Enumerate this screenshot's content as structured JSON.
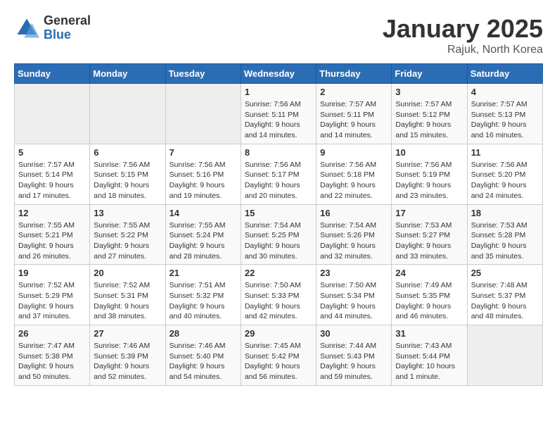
{
  "logo": {
    "general": "General",
    "blue": "Blue"
  },
  "title": "January 2025",
  "subtitle": "Rajuk, North Korea",
  "days_of_week": [
    "Sunday",
    "Monday",
    "Tuesday",
    "Wednesday",
    "Thursday",
    "Friday",
    "Saturday"
  ],
  "weeks": [
    [
      {
        "day": "",
        "empty": true
      },
      {
        "day": "",
        "empty": true
      },
      {
        "day": "",
        "empty": true
      },
      {
        "day": "1",
        "sunrise": "7:56 AM",
        "sunset": "5:11 PM",
        "daylight": "9 hours and 14 minutes."
      },
      {
        "day": "2",
        "sunrise": "7:57 AM",
        "sunset": "5:11 PM",
        "daylight": "9 hours and 14 minutes."
      },
      {
        "day": "3",
        "sunrise": "7:57 AM",
        "sunset": "5:12 PM",
        "daylight": "9 hours and 15 minutes."
      },
      {
        "day": "4",
        "sunrise": "7:57 AM",
        "sunset": "5:13 PM",
        "daylight": "9 hours and 16 minutes."
      }
    ],
    [
      {
        "day": "5",
        "sunrise": "7:57 AM",
        "sunset": "5:14 PM",
        "daylight": "9 hours and 17 minutes."
      },
      {
        "day": "6",
        "sunrise": "7:56 AM",
        "sunset": "5:15 PM",
        "daylight": "9 hours and 18 minutes."
      },
      {
        "day": "7",
        "sunrise": "7:56 AM",
        "sunset": "5:16 PM",
        "daylight": "9 hours and 19 minutes."
      },
      {
        "day": "8",
        "sunrise": "7:56 AM",
        "sunset": "5:17 PM",
        "daylight": "9 hours and 20 minutes."
      },
      {
        "day": "9",
        "sunrise": "7:56 AM",
        "sunset": "5:18 PM",
        "daylight": "9 hours and 22 minutes."
      },
      {
        "day": "10",
        "sunrise": "7:56 AM",
        "sunset": "5:19 PM",
        "daylight": "9 hours and 23 minutes."
      },
      {
        "day": "11",
        "sunrise": "7:56 AM",
        "sunset": "5:20 PM",
        "daylight": "9 hours and 24 minutes."
      }
    ],
    [
      {
        "day": "12",
        "sunrise": "7:55 AM",
        "sunset": "5:21 PM",
        "daylight": "9 hours and 26 minutes."
      },
      {
        "day": "13",
        "sunrise": "7:55 AM",
        "sunset": "5:22 PM",
        "daylight": "9 hours and 27 minutes."
      },
      {
        "day": "14",
        "sunrise": "7:55 AM",
        "sunset": "5:24 PM",
        "daylight": "9 hours and 28 minutes."
      },
      {
        "day": "15",
        "sunrise": "7:54 AM",
        "sunset": "5:25 PM",
        "daylight": "9 hours and 30 minutes."
      },
      {
        "day": "16",
        "sunrise": "7:54 AM",
        "sunset": "5:26 PM",
        "daylight": "9 hours and 32 minutes."
      },
      {
        "day": "17",
        "sunrise": "7:53 AM",
        "sunset": "5:27 PM",
        "daylight": "9 hours and 33 minutes."
      },
      {
        "day": "18",
        "sunrise": "7:53 AM",
        "sunset": "5:28 PM",
        "daylight": "9 hours and 35 minutes."
      }
    ],
    [
      {
        "day": "19",
        "sunrise": "7:52 AM",
        "sunset": "5:29 PM",
        "daylight": "9 hours and 37 minutes."
      },
      {
        "day": "20",
        "sunrise": "7:52 AM",
        "sunset": "5:31 PM",
        "daylight": "9 hours and 38 minutes."
      },
      {
        "day": "21",
        "sunrise": "7:51 AM",
        "sunset": "5:32 PM",
        "daylight": "9 hours and 40 minutes."
      },
      {
        "day": "22",
        "sunrise": "7:50 AM",
        "sunset": "5:33 PM",
        "daylight": "9 hours and 42 minutes."
      },
      {
        "day": "23",
        "sunrise": "7:50 AM",
        "sunset": "5:34 PM",
        "daylight": "9 hours and 44 minutes."
      },
      {
        "day": "24",
        "sunrise": "7:49 AM",
        "sunset": "5:35 PM",
        "daylight": "9 hours and 46 minutes."
      },
      {
        "day": "25",
        "sunrise": "7:48 AM",
        "sunset": "5:37 PM",
        "daylight": "9 hours and 48 minutes."
      }
    ],
    [
      {
        "day": "26",
        "sunrise": "7:47 AM",
        "sunset": "5:38 PM",
        "daylight": "9 hours and 50 minutes."
      },
      {
        "day": "27",
        "sunrise": "7:46 AM",
        "sunset": "5:39 PM",
        "daylight": "9 hours and 52 minutes."
      },
      {
        "day": "28",
        "sunrise": "7:46 AM",
        "sunset": "5:40 PM",
        "daylight": "9 hours and 54 minutes."
      },
      {
        "day": "29",
        "sunrise": "7:45 AM",
        "sunset": "5:42 PM",
        "daylight": "9 hours and 56 minutes."
      },
      {
        "day": "30",
        "sunrise": "7:44 AM",
        "sunset": "5:43 PM",
        "daylight": "9 hours and 59 minutes."
      },
      {
        "day": "31",
        "sunrise": "7:43 AM",
        "sunset": "5:44 PM",
        "daylight": "10 hours and 1 minute."
      },
      {
        "day": "",
        "empty": true
      }
    ]
  ]
}
